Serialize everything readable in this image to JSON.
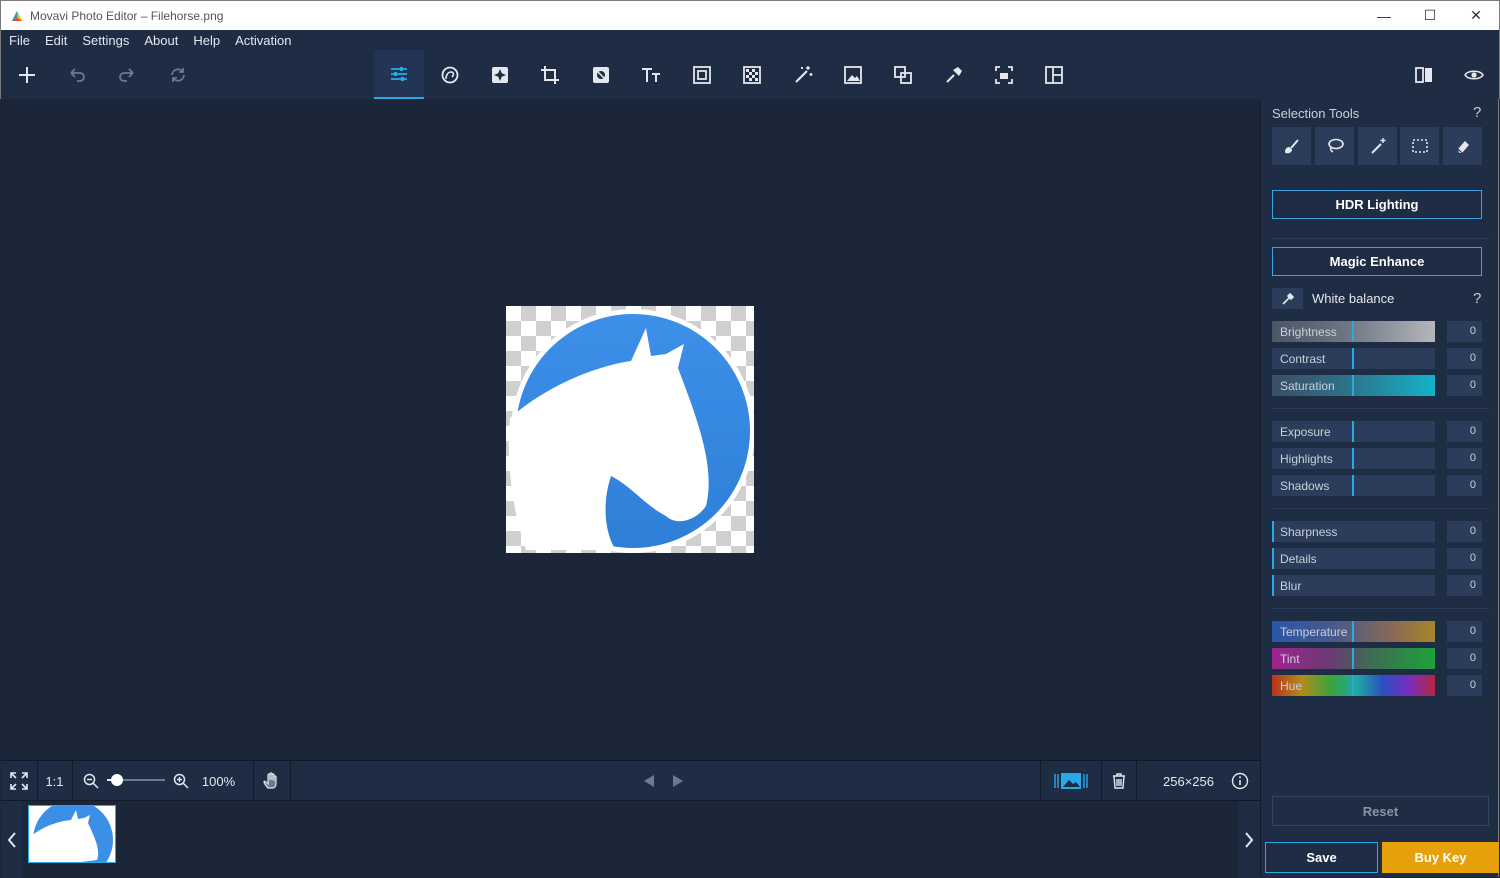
{
  "window": {
    "title": "Movavi Photo Editor – Filehorse.png",
    "minimize": "—",
    "maximize": "☐",
    "close": "✕"
  },
  "menu": [
    "File",
    "Edit",
    "Settings",
    "About",
    "Help",
    "Activation"
  ],
  "toolbar": {
    "left_icons": [
      "add-icon",
      "undo-icon",
      "redo-icon",
      "reset-rotate-icon"
    ],
    "tools": [
      "adjust-icon",
      "retouch-icon",
      "effects-icon",
      "crop-icon",
      "object-removal-icon",
      "text-icon",
      "frames-icon",
      "background-icon",
      "magic-wand-icon",
      "insert-image-icon",
      "transform-icon",
      "enhance-pin-icon",
      "resize-icon",
      "layout-icon"
    ],
    "active_tool": "adjust-icon",
    "right_icons": [
      "compare-icon",
      "preview-eye-icon"
    ]
  },
  "panel": {
    "selection_title": "Selection Tools",
    "help": "?",
    "selection_tools": [
      "brush-select-icon",
      "lasso-icon",
      "magic-select-icon",
      "rect-select-icon",
      "eraser-icon"
    ],
    "hdr_label": "HDR Lighting",
    "magic_label": "Magic Enhance",
    "white_balance": "White balance",
    "groups": [
      [
        {
          "label": "Brightness",
          "value": "0",
          "style": "brightness"
        },
        {
          "label": "Contrast",
          "value": "0",
          "style": "plain"
        },
        {
          "label": "Saturation",
          "value": "0",
          "style": "saturation"
        }
      ],
      [
        {
          "label": "Exposure",
          "value": "0",
          "style": "plain"
        },
        {
          "label": "Highlights",
          "value": "0",
          "style": "plain"
        },
        {
          "label": "Shadows",
          "value": "0",
          "style": "plain"
        }
      ],
      [
        {
          "label": "Sharpness",
          "value": "0",
          "style": "left"
        },
        {
          "label": "Details",
          "value": "0",
          "style": "left"
        },
        {
          "label": "Blur",
          "value": "0",
          "style": "left"
        }
      ],
      [
        {
          "label": "Temperature",
          "value": "0",
          "style": "temperature"
        },
        {
          "label": "Tint",
          "value": "0",
          "style": "tint"
        },
        {
          "label": "Hue",
          "value": "0",
          "style": "hue"
        }
      ]
    ],
    "reset_label": "Reset",
    "save_label": "Save",
    "buy_label": "Buy Key"
  },
  "bottom": {
    "ratio": "1:1",
    "zoom": "100%",
    "zoom_slider_fraction": 0.15,
    "dimensions": "256×256"
  },
  "colors": {
    "accent": "#2aa9e8",
    "buy": "#e6a10a",
    "logo_blue": "#3b8fe6"
  }
}
